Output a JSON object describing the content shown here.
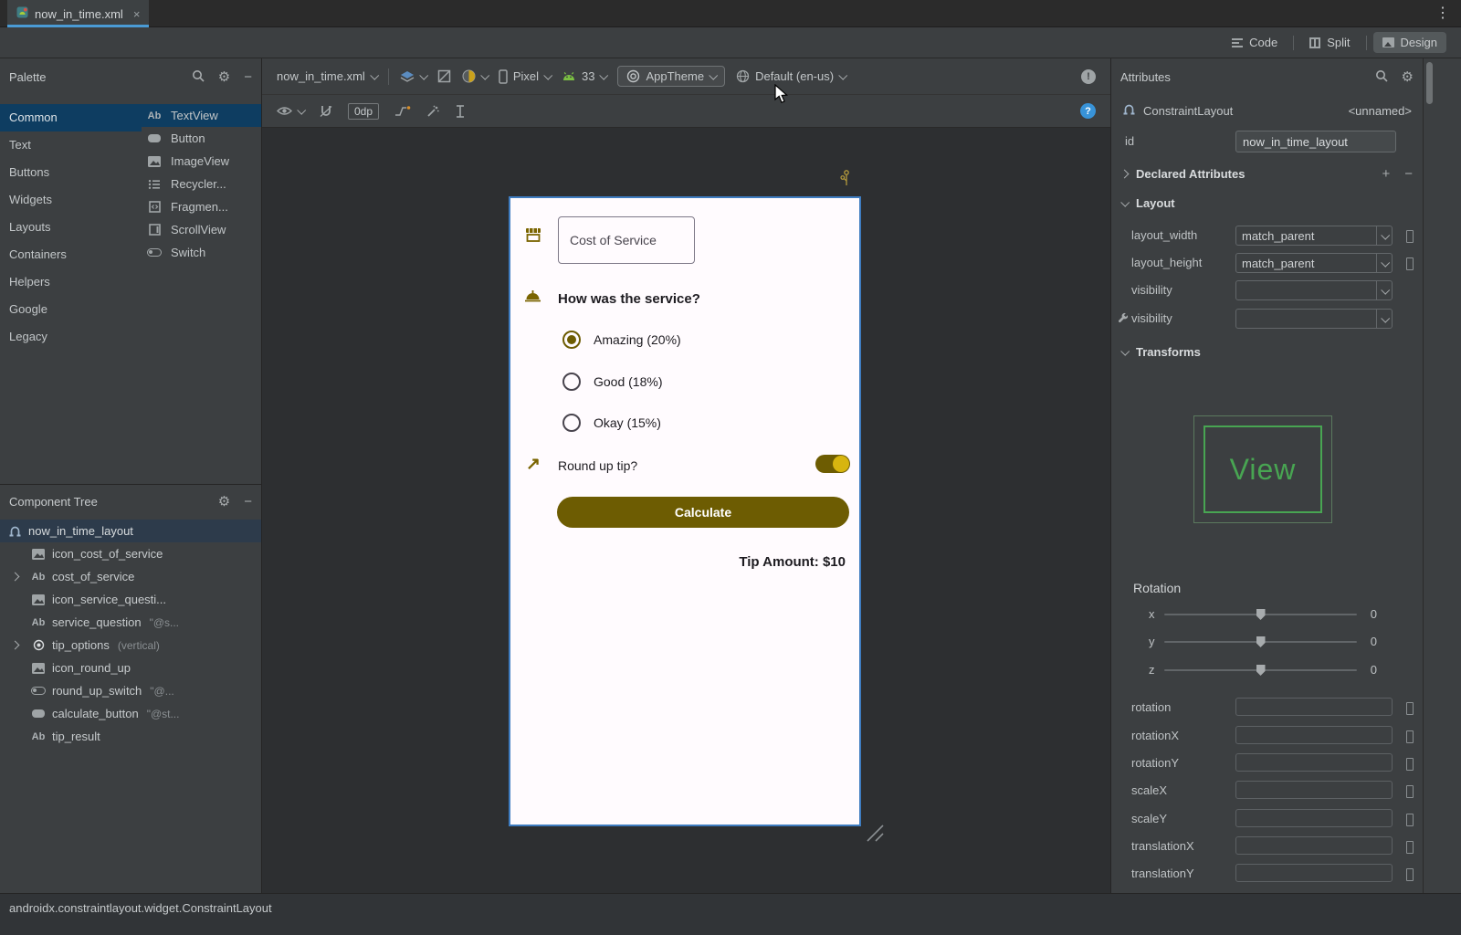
{
  "window": {
    "kebab": "⋮"
  },
  "tab_bar": {
    "active_tab": "now_in_time.xml",
    "close": "×"
  },
  "mode_toggle": {
    "code": "Code",
    "split": "Split",
    "design": "Design"
  },
  "palette": {
    "title": "Palette",
    "categories": [
      "Common",
      "Text",
      "Buttons",
      "Widgets",
      "Layouts",
      "Containers",
      "Helpers",
      "Google",
      "Legacy"
    ],
    "ab_glyph": "Ab",
    "items": [
      {
        "label": "TextView"
      },
      {
        "label": "Button"
      },
      {
        "label": "ImageView"
      },
      {
        "label": "Recycler..."
      },
      {
        "label": "Fragmen..."
      },
      {
        "label": "ScrollView"
      },
      {
        "label": "Switch"
      }
    ]
  },
  "component_tree": {
    "title": "Component Tree",
    "items": [
      {
        "label": "now_in_time_layout",
        "suffix": ""
      },
      {
        "label": "icon_cost_of_service",
        "suffix": ""
      },
      {
        "label": "cost_of_service",
        "suffix": ""
      },
      {
        "label": "icon_service_questi...",
        "suffix": ""
      },
      {
        "label": "service_question",
        "suffix": "\"@s..."
      },
      {
        "label": "tip_options",
        "suffix": "(vertical)"
      },
      {
        "label": "icon_round_up",
        "suffix": ""
      },
      {
        "label": "round_up_switch",
        "suffix": "\"@..."
      },
      {
        "label": "calculate_button",
        "suffix": "\"@st..."
      },
      {
        "label": "tip_result",
        "suffix": ""
      }
    ]
  },
  "design_toolbar": {
    "file": "now_in_time.xml",
    "device": "Pixel",
    "api_level": "33",
    "theme": "AppTheme",
    "locale": "Default (en-us)",
    "margin": "0dp",
    "error_glyph": "!",
    "help_glyph": "?"
  },
  "canvas": {
    "cost_of_service_label": "Cost of Service",
    "service_question": "How was the service?",
    "tip_options": [
      {
        "label": "Amazing (20%)",
        "selected": true
      },
      {
        "label": "Good (18%)",
        "selected": false
      },
      {
        "label": "Okay (15%)",
        "selected": false
      }
    ],
    "round_up_icon": "↗",
    "round_up_label": "Round up tip?",
    "round_up_on": true,
    "calculate_label": "Calculate",
    "tip_result": "Tip Amount: $10"
  },
  "attributes_panel": {
    "title": "Attributes",
    "component_type": "ConstraintLayout",
    "component_name": "<unnamed>",
    "id_label": "id",
    "id_value": "now_in_time_layout",
    "sections": {
      "declared": "Declared Attributes",
      "layout": "Layout",
      "transforms": "Transforms"
    },
    "section_icons": {
      "add": "+",
      "remove": "−"
    },
    "layout_rows": [
      {
        "label": "layout_width",
        "value": "match_parent"
      },
      {
        "label": "layout_height",
        "value": "match_parent"
      },
      {
        "label": "visibility",
        "value": ""
      },
      {
        "label": "visibility",
        "value": ""
      }
    ],
    "view_preview": "View",
    "rotation_title": "Rotation",
    "rotation_sliders": [
      {
        "axis": "x",
        "value": "0"
      },
      {
        "axis": "y",
        "value": "0"
      },
      {
        "axis": "z",
        "value": "0"
      }
    ],
    "transform_fields": [
      {
        "label": "rotation"
      },
      {
        "label": "rotationX"
      },
      {
        "label": "rotationY"
      },
      {
        "label": "scaleX"
      },
      {
        "label": "scaleY"
      },
      {
        "label": "translationX"
      },
      {
        "label": "translationY"
      }
    ]
  },
  "status_bar": {
    "text": "androidx.constraintlayout.widget.ConstraintLayout"
  },
  "colors": {
    "accent_gold": "#7a6400",
    "accent_gold_bright": "#d7b50f",
    "view_green": "#48a552",
    "selection_blue": "#0e3d61",
    "tab_accent": "#4a9bd5",
    "phone_border": "#3e7cc0",
    "screen_bg": "#fffbfe"
  }
}
